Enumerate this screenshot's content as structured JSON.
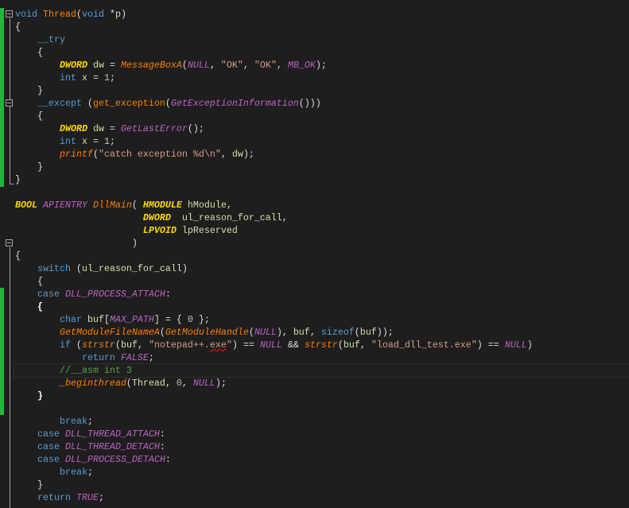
{
  "colors": {
    "background": "#1e1e1e",
    "keyword": "#569cd6",
    "function": "#ff8000",
    "type": "#ffd700",
    "macro": "#bd63c5",
    "string": "#d69d85",
    "comment": "#57a64a",
    "change_marker": "#1fb83a"
  },
  "current_line": 28,
  "lines": [
    {
      "tokens": [
        {
          "t": "void",
          "c": "kw"
        },
        {
          "t": " "
        },
        {
          "t": "Thread",
          "c": "fn"
        },
        {
          "t": "("
        },
        {
          "t": "void",
          "c": "kw"
        },
        {
          "t": " *"
        },
        {
          "t": "p",
          "c": "var"
        },
        {
          "t": ")"
        }
      ]
    },
    {
      "tokens": [
        {
          "t": "{"
        }
      ]
    },
    {
      "tokens": [
        {
          "t": "    "
        },
        {
          "t": "__try",
          "c": "kw"
        }
      ]
    },
    {
      "tokens": [
        {
          "t": "    {"
        }
      ]
    },
    {
      "tokens": [
        {
          "t": "        "
        },
        {
          "t": "DWORD",
          "c": "ty"
        },
        {
          "t": " "
        },
        {
          "t": "dw",
          "c": "var"
        },
        {
          "t": " = "
        },
        {
          "t": "MessageBoxA",
          "c": "fni"
        },
        {
          "t": "("
        },
        {
          "t": "NULL",
          "c": "mc"
        },
        {
          "t": ", "
        },
        {
          "t": "\"OK\"",
          "c": "st"
        },
        {
          "t": ", "
        },
        {
          "t": "\"OK\"",
          "c": "st"
        },
        {
          "t": ", "
        },
        {
          "t": "MB_OK",
          "c": "mc"
        },
        {
          "t": ");"
        }
      ]
    },
    {
      "tokens": [
        {
          "t": "        "
        },
        {
          "t": "int",
          "c": "kw"
        },
        {
          "t": " "
        },
        {
          "t": "x",
          "c": "var"
        },
        {
          "t": " = "
        },
        {
          "t": "1",
          "c": "num"
        },
        {
          "t": ";"
        }
      ]
    },
    {
      "tokens": [
        {
          "t": "    }"
        }
      ]
    },
    {
      "tokens": [
        {
          "t": "    "
        },
        {
          "t": "__except",
          "c": "kw"
        },
        {
          "t": " ("
        },
        {
          "t": "get_exception",
          "c": "fn"
        },
        {
          "t": "("
        },
        {
          "t": "GetExceptionInformation",
          "c": "mc"
        },
        {
          "t": "()))"
        }
      ]
    },
    {
      "tokens": [
        {
          "t": "    {"
        }
      ]
    },
    {
      "tokens": [
        {
          "t": "        "
        },
        {
          "t": "DWORD",
          "c": "ty"
        },
        {
          "t": " "
        },
        {
          "t": "dw",
          "c": "var"
        },
        {
          "t": " = "
        },
        {
          "t": "GetLastError",
          "c": "mc"
        },
        {
          "t": "();"
        }
      ]
    },
    {
      "tokens": [
        {
          "t": "        "
        },
        {
          "t": "int",
          "c": "kw"
        },
        {
          "t": " "
        },
        {
          "t": "x",
          "c": "var"
        },
        {
          "t": " = "
        },
        {
          "t": "1",
          "c": "num"
        },
        {
          "t": ";"
        }
      ]
    },
    {
      "tokens": [
        {
          "t": "        "
        },
        {
          "t": "printf",
          "c": "fni"
        },
        {
          "t": "("
        },
        {
          "t": "\"catch exception %d\\n\"",
          "c": "st"
        },
        {
          "t": ", "
        },
        {
          "t": "dw",
          "c": "var"
        },
        {
          "t": ");"
        }
      ]
    },
    {
      "tokens": [
        {
          "t": "    }"
        }
      ]
    },
    {
      "tokens": [
        {
          "t": "}"
        }
      ]
    },
    {
      "tokens": []
    },
    {
      "tokens": [
        {
          "t": "BOOL",
          "c": "ty"
        },
        {
          "t": " "
        },
        {
          "t": "APIENTRY",
          "c": "mc"
        },
        {
          "t": " "
        },
        {
          "t": "DllMain",
          "c": "fni"
        },
        {
          "t": "( "
        },
        {
          "t": "HMODULE",
          "c": "ty"
        },
        {
          "t": " "
        },
        {
          "t": "hModule",
          "c": "var"
        },
        {
          "t": ","
        }
      ]
    },
    {
      "tokens": [
        {
          "t": "                       "
        },
        {
          "t": "DWORD",
          "c": "ty"
        },
        {
          "t": "  "
        },
        {
          "t": "ul_reason_for_call",
          "c": "var"
        },
        {
          "t": ","
        }
      ]
    },
    {
      "tokens": [
        {
          "t": "                       "
        },
        {
          "t": "LPVOID",
          "c": "ty"
        },
        {
          "t": " "
        },
        {
          "t": "lpReserved",
          "c": "var"
        }
      ]
    },
    {
      "tokens": [
        {
          "t": "                     )"
        }
      ]
    },
    {
      "tokens": [
        {
          "t": "{"
        }
      ]
    },
    {
      "tokens": [
        {
          "t": "    "
        },
        {
          "t": "switch",
          "c": "kw"
        },
        {
          "t": " ("
        },
        {
          "t": "ul_reason_for_call",
          "c": "var"
        },
        {
          "t": ")"
        }
      ]
    },
    {
      "tokens": [
        {
          "t": "    {"
        }
      ]
    },
    {
      "tokens": [
        {
          "t": "    "
        },
        {
          "t": "case",
          "c": "kw"
        },
        {
          "t": " "
        },
        {
          "t": "DLL_PROCESS_ATTACH",
          "c": "mc"
        },
        {
          "t": ":"
        }
      ]
    },
    {
      "tokens": [
        {
          "t": "    "
        },
        {
          "t": "{",
          "c": "bb"
        }
      ]
    },
    {
      "tokens": [
        {
          "t": "        "
        },
        {
          "t": "char",
          "c": "kw"
        },
        {
          "t": " "
        },
        {
          "t": "buf",
          "c": "var"
        },
        {
          "t": "["
        },
        {
          "t": "MAX_PATH",
          "c": "mc"
        },
        {
          "t": "] = { "
        },
        {
          "t": "0",
          "c": "num"
        },
        {
          "t": " };"
        }
      ]
    },
    {
      "tokens": [
        {
          "t": "        "
        },
        {
          "t": "GetModuleFileNameA",
          "c": "fni"
        },
        {
          "t": "("
        },
        {
          "t": "GetModuleHandle",
          "c": "fni"
        },
        {
          "t": "("
        },
        {
          "t": "NULL",
          "c": "mc"
        },
        {
          "t": "), "
        },
        {
          "t": "buf",
          "c": "var"
        },
        {
          "t": ", "
        },
        {
          "t": "sizeof",
          "c": "kw"
        },
        {
          "t": "("
        },
        {
          "t": "buf",
          "c": "var"
        },
        {
          "t": "));"
        }
      ]
    },
    {
      "tokens": [
        {
          "t": "        "
        },
        {
          "t": "if",
          "c": "kw"
        },
        {
          "t": " ("
        },
        {
          "t": "strstr",
          "c": "fni"
        },
        {
          "t": "("
        },
        {
          "t": "buf",
          "c": "var"
        },
        {
          "t": ", "
        },
        {
          "t": "\"notepad++.",
          "c": "st"
        },
        {
          "t": "exe",
          "c": "sq"
        },
        {
          "t": "\"",
          "c": "st"
        },
        {
          "t": ") == "
        },
        {
          "t": "NULL",
          "c": "mc"
        },
        {
          "t": " && "
        },
        {
          "t": "strstr",
          "c": "fni"
        },
        {
          "t": "("
        },
        {
          "t": "buf",
          "c": "var"
        },
        {
          "t": ", "
        },
        {
          "t": "\"load_dll_test.exe\"",
          "c": "st"
        },
        {
          "t": ") == "
        },
        {
          "t": "NULL",
          "c": "mc"
        },
        {
          "t": ")"
        }
      ]
    },
    {
      "tokens": [
        {
          "t": "            "
        },
        {
          "t": "return",
          "c": "kw"
        },
        {
          "t": " "
        },
        {
          "t": "FALSE",
          "c": "mc"
        },
        {
          "t": ";"
        }
      ]
    },
    {
      "tokens": [
        {
          "t": "        "
        },
        {
          "t": "//__asm int 3",
          "c": "cm"
        }
      ]
    },
    {
      "tokens": [
        {
          "t": "        "
        },
        {
          "t": "_beginthread",
          "c": "fni"
        },
        {
          "t": "("
        },
        {
          "t": "Thread",
          "c": "var"
        },
        {
          "t": ", "
        },
        {
          "t": "0",
          "c": "num"
        },
        {
          "t": ", "
        },
        {
          "t": "NULL",
          "c": "mc"
        },
        {
          "t": ");"
        }
      ]
    },
    {
      "tokens": [
        {
          "t": "    "
        },
        {
          "t": "}",
          "c": "bb"
        }
      ]
    },
    {
      "tokens": []
    },
    {
      "tokens": [
        {
          "t": "        "
        },
        {
          "t": "break",
          "c": "kw"
        },
        {
          "t": ";"
        }
      ]
    },
    {
      "tokens": [
        {
          "t": "    "
        },
        {
          "t": "case",
          "c": "kw"
        },
        {
          "t": " "
        },
        {
          "t": "DLL_THREAD_ATTACH",
          "c": "mc"
        },
        {
          "t": ":"
        }
      ]
    },
    {
      "tokens": [
        {
          "t": "    "
        },
        {
          "t": "case",
          "c": "kw"
        },
        {
          "t": " "
        },
        {
          "t": "DLL_THREAD_DETACH",
          "c": "mc"
        },
        {
          "t": ":"
        }
      ]
    },
    {
      "tokens": [
        {
          "t": "    "
        },
        {
          "t": "case",
          "c": "kw"
        },
        {
          "t": " "
        },
        {
          "t": "DLL_PROCESS_DETACH",
          "c": "mc"
        },
        {
          "t": ":"
        }
      ]
    },
    {
      "tokens": [
        {
          "t": "        "
        },
        {
          "t": "break",
          "c": "kw"
        },
        {
          "t": ";"
        }
      ]
    },
    {
      "tokens": [
        {
          "t": "    }"
        }
      ]
    },
    {
      "tokens": [
        {
          "t": "    "
        },
        {
          "t": "return",
          "c": "kw"
        },
        {
          "t": " "
        },
        {
          "t": "TRUE",
          "c": "mc"
        },
        {
          "t": ";"
        }
      ]
    }
  ]
}
